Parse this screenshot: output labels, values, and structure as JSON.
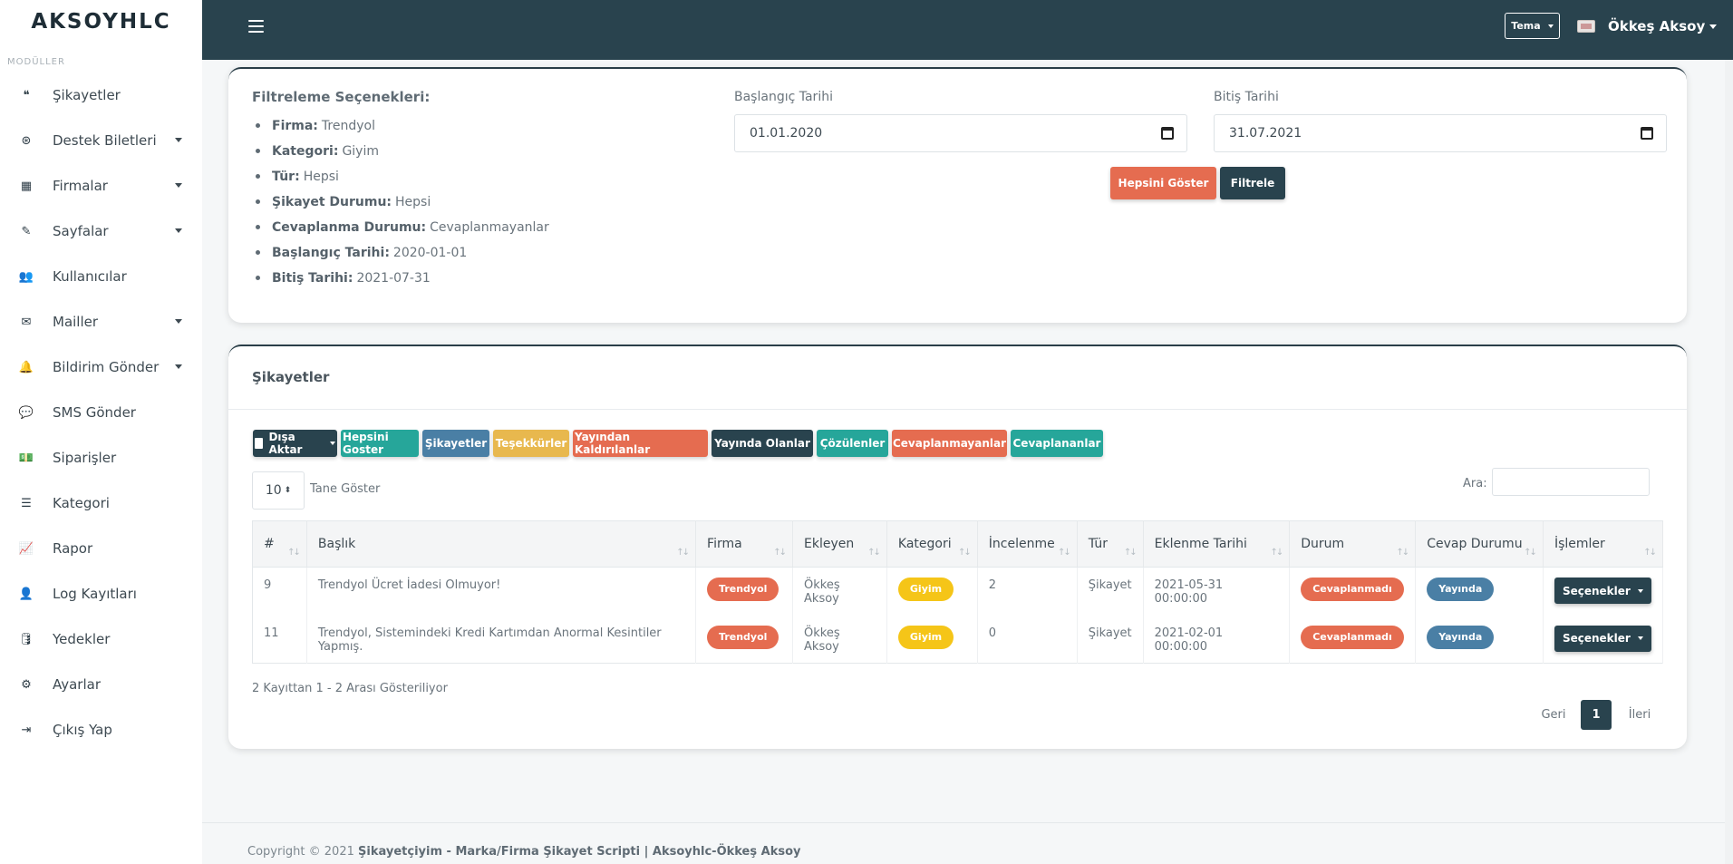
{
  "brand": "AKSOYHLC",
  "sidebar": {
    "section": "MODÜLLER",
    "items": [
      {
        "label": "Şikayetler",
        "icon": "quote-icon",
        "glyph": "❝",
        "dropdown": false
      },
      {
        "label": "Destek Biletleri",
        "icon": "lifebuoy-icon",
        "glyph": "⊛",
        "dropdown": true
      },
      {
        "label": "Firmalar",
        "icon": "building-icon",
        "glyph": "▦",
        "dropdown": true
      },
      {
        "label": "Sayfalar",
        "icon": "edit-file-icon",
        "glyph": "✎",
        "dropdown": true
      },
      {
        "label": "Kullanıcılar",
        "icon": "users-icon",
        "glyph": "👥",
        "dropdown": false
      },
      {
        "label": "Mailler",
        "icon": "envelope-icon",
        "glyph": "✉",
        "dropdown": true
      },
      {
        "label": "Bildirim Gönder",
        "icon": "bell-icon",
        "glyph": "🔔",
        "dropdown": true
      },
      {
        "label": "SMS Gönder",
        "icon": "comment-icon",
        "glyph": "💬",
        "dropdown": false
      },
      {
        "label": "Siparişler",
        "icon": "money-icon",
        "glyph": "💵",
        "dropdown": false
      },
      {
        "label": "Kategori",
        "icon": "list-icon",
        "glyph": "☰",
        "dropdown": false
      },
      {
        "label": "Rapor",
        "icon": "chart-icon",
        "glyph": "📈",
        "dropdown": false
      },
      {
        "label": "Log Kayıtları",
        "icon": "user-lock-icon",
        "glyph": "👤",
        "dropdown": false
      },
      {
        "label": "Yedekler",
        "icon": "database-icon",
        "glyph": "🛢",
        "dropdown": false
      },
      {
        "label": "Ayarlar",
        "icon": "cogs-icon",
        "glyph": "⚙",
        "dropdown": false
      },
      {
        "label": "Çıkış Yap",
        "icon": "sign-out-icon",
        "glyph": "⇥",
        "dropdown": false
      }
    ]
  },
  "topbar": {
    "theme_label": "Tema",
    "user_name": "Ökkeş Aksoy"
  },
  "filter": {
    "title": "Filtreleme Seçenekleri:",
    "items": [
      {
        "key": "Firma:",
        "value": "Trendyol"
      },
      {
        "key": "Kategori:",
        "value": "Giyim"
      },
      {
        "key": "Tür:",
        "value": "Hepsi"
      },
      {
        "key": "Şikayet Durumu:",
        "value": "Hepsi"
      },
      {
        "key": "Cevaplanma Durumu:",
        "value": "Cevaplanmayanlar"
      },
      {
        "key": "Başlangıç Tarihi:",
        "value": "2020-01-01"
      },
      {
        "key": "Bitiş Tarihi:",
        "value": "2021-07-31"
      }
    ],
    "start_label": "Başlangıç Tarihi",
    "start_value": "01.01.2020",
    "end_label": "Bitiş Tarihi",
    "end_value": "31.07.2021",
    "show_all": "Hepsini Göster",
    "apply": "Filtrele"
  },
  "complaints": {
    "title": "Şikayetler",
    "buttons": [
      {
        "label": "Dışa Aktar",
        "color": "#29434e"
      },
      {
        "label": "Hepsini Goster",
        "color": "#26a69a"
      },
      {
        "label": "Şikayetler",
        "color": "#4a7fa5"
      },
      {
        "label": "Teşekkürler",
        "color": "#e8b84e"
      },
      {
        "label": "Yayından Kaldırılanlar",
        "color": "#e56c50"
      },
      {
        "label": "Yayında Olanlar",
        "color": "#29434e"
      },
      {
        "label": "Çözülenler",
        "color": "#26a69a"
      },
      {
        "label": "Cevaplanmayanlar",
        "color": "#e56c50"
      },
      {
        "label": "Cevaplananlar",
        "color": "#26a69a"
      }
    ],
    "page_length": "10",
    "page_length_label": "Tane Göster",
    "search_label": "Ara:",
    "search_value": "",
    "columns": [
      "#",
      "Başlık",
      "Firma",
      "Ekleyen",
      "Kategori",
      "İncelenme",
      "Tür",
      "Eklenme Tarihi",
      "Durum",
      "Cevap Durumu",
      "İşlemler"
    ],
    "rows": [
      {
        "id": "9",
        "title": "Trendyol Ücret İadesi Olmuyor!",
        "company": "Trendyol",
        "author": "Ökkeş Aksoy",
        "category": "Giyim",
        "views": "2",
        "type": "Şikayet",
        "date": "2021-05-31 00:00:00",
        "status": "Cevaplanmadı",
        "answer": "Yayında",
        "action": "Seçenekler"
      },
      {
        "id": "11",
        "title": "Trendyol, Sistemindeki Kredi Kartımdan Anormal Kesintiler Yapmış.",
        "company": "Trendyol",
        "author": "Ökkeş Aksoy",
        "category": "Giyim",
        "views": "0",
        "type": "Şikayet",
        "date": "2021-02-01 00:00:00",
        "status": "Cevaplanmadı",
        "answer": "Yayında",
        "action": "Seçenekler"
      }
    ],
    "info": "2 Kayıttan 1 - 2 Arası Gösteriliyor",
    "pagination": {
      "prev": "Geri",
      "current": "1",
      "next": "İleri"
    }
  },
  "footer": {
    "prefix": "Copyright © 2021 ",
    "text": "Şikayetçiyim - Marka/Firma Şikayet Scripti | Aksoyhlc-Ökkeş Aksoy"
  },
  "colors": {
    "topbar": "#29434e",
    "orange": "#e56c50",
    "teal": "#26a69a",
    "blue": "#4a7fa5",
    "yellow": "#f5c518"
  }
}
